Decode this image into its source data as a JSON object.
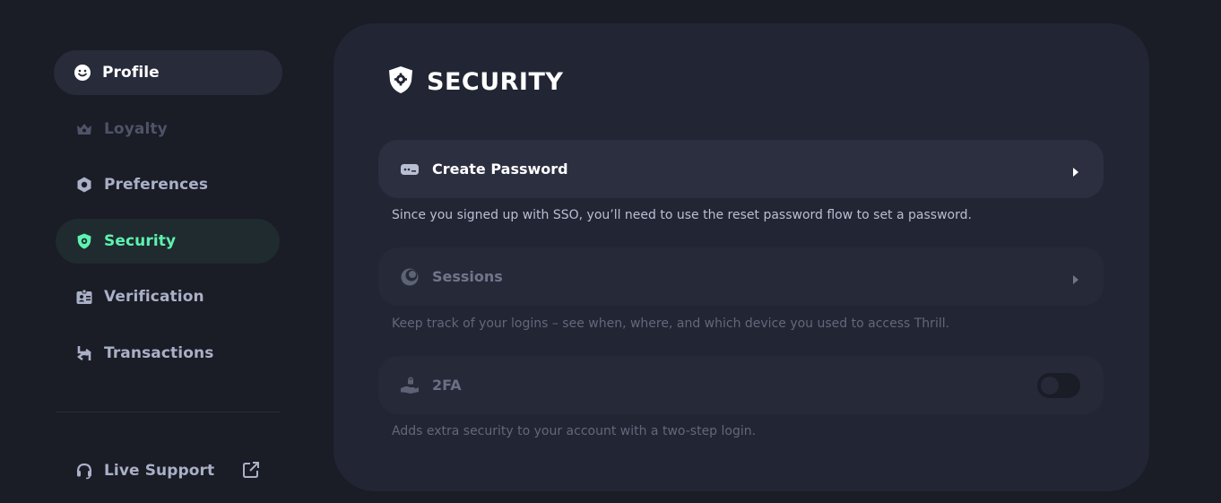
{
  "sidebar": {
    "items": [
      {
        "key": "profile",
        "label": "Profile",
        "icon": "smile-icon"
      },
      {
        "key": "loyalty",
        "label": "Loyalty",
        "icon": "crown-icon"
      },
      {
        "key": "preferences",
        "label": "Preferences",
        "icon": "hexagon-icon"
      },
      {
        "key": "security",
        "label": "Security",
        "icon": "shield-icon"
      },
      {
        "key": "verification",
        "label": "Verification",
        "icon": "id-card-icon"
      },
      {
        "key": "transactions",
        "label": "Transactions",
        "icon": "transfer-arrows-icon"
      }
    ],
    "support": {
      "label": "Live Support",
      "icon": "headset-icon",
      "ext_icon": "external-link-icon"
    },
    "active": "security"
  },
  "main": {
    "title": "SECURITY",
    "title_icon": "shield-icon",
    "rows": {
      "create_password": {
        "label": "Create Password",
        "icon": "password-icon",
        "description": "Since you signed up with SSO, you’ll need to use the reset password flow to set a password."
      },
      "sessions": {
        "label": "Sessions",
        "icon": "sessions-icon",
        "description": "Keep track of your logins – see when, where, and which device you used to access Thrill."
      },
      "twofa": {
        "label": "2FA",
        "icon": "lock-hand-icon",
        "description": "Adds extra security to your account with a two-step login.",
        "enabled": false
      }
    }
  },
  "colors": {
    "background": "#1a1c26",
    "card": "#222533",
    "accent": "#5ef2b0",
    "text_muted": "#aab0c6"
  }
}
